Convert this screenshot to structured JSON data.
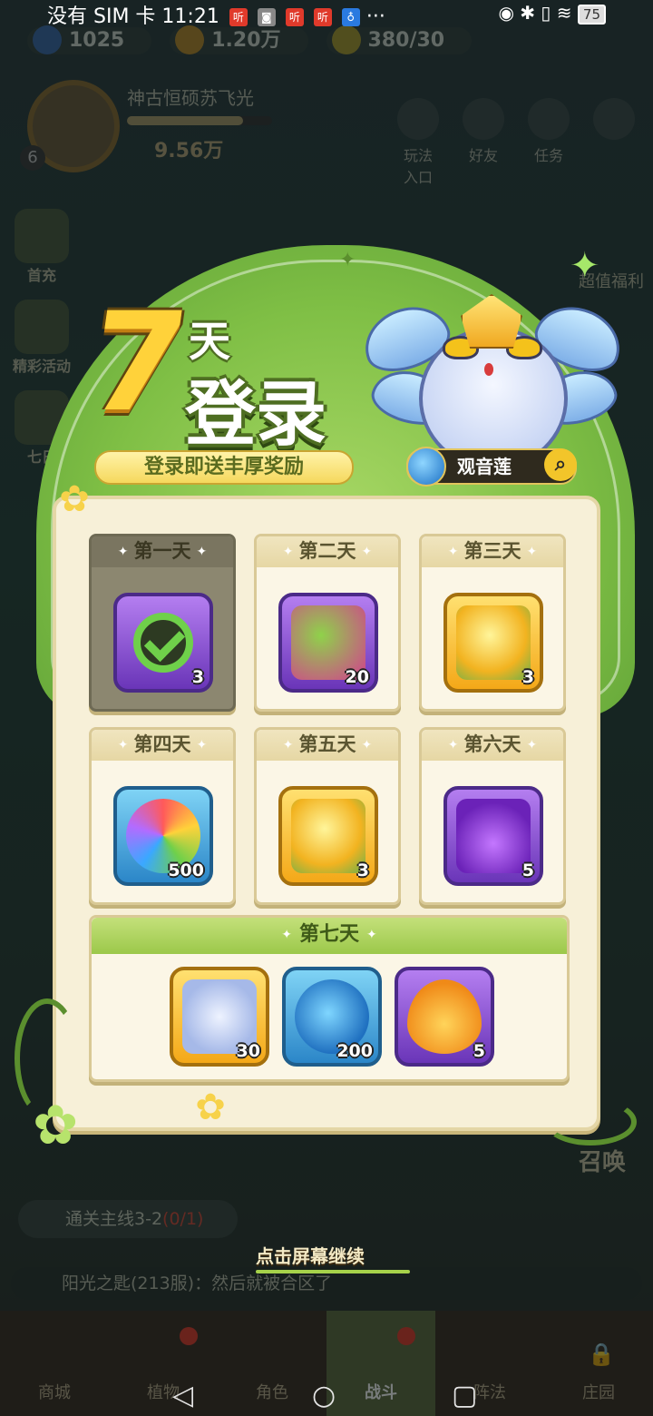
{
  "status_bar": {
    "carrier": "没有 SIM 卡",
    "time": "11:21",
    "battery": "75"
  },
  "resources": [
    {
      "name": "diamond",
      "value": "1025"
    },
    {
      "name": "coin",
      "value": "1.20万"
    },
    {
      "name": "energy",
      "value": "380/30"
    }
  ],
  "player": {
    "name": "神古恒硕苏飞光",
    "level": "6",
    "power": "9.56万"
  },
  "top_icons": [
    "玩法入口",
    "好友",
    "任务"
  ],
  "side_left": [
    "首充",
    "精彩活动",
    "七日"
  ],
  "side_right": [
    "超值福利"
  ],
  "popup": {
    "title_number": "7",
    "title_day": "天",
    "title_login": "登录",
    "subtitle": "登录即送丰厚奖励",
    "hero_name": "观音莲",
    "days": [
      {
        "label": "第一天",
        "qty": "3",
        "claimed": true
      },
      {
        "label": "第二天",
        "qty": "20"
      },
      {
        "label": "第三天",
        "qty": "3"
      },
      {
        "label": "第四天",
        "qty": "500"
      },
      {
        "label": "第五天",
        "qty": "3"
      },
      {
        "label": "第六天",
        "qty": "5"
      }
    ],
    "day7": {
      "label": "第七天",
      "rewards": [
        "30",
        "200",
        "5"
      ]
    }
  },
  "continue_hint": "点击屏幕继续",
  "quest": {
    "text": "通关主线3-2",
    "count": "(0/1)"
  },
  "chat": {
    "text": "阳光之匙(213服)：然后就被合区了"
  },
  "bottom_nav": [
    "商城",
    "植物",
    "角色",
    "战斗",
    "阵法",
    "庄园"
  ],
  "right_labels": [
    "召唤"
  ],
  "colors": {
    "panel": "#f7f0d8",
    "leaf": "#7fbf45",
    "title_gold": "#ffd23a",
    "badge_red": "#e03a2b"
  }
}
